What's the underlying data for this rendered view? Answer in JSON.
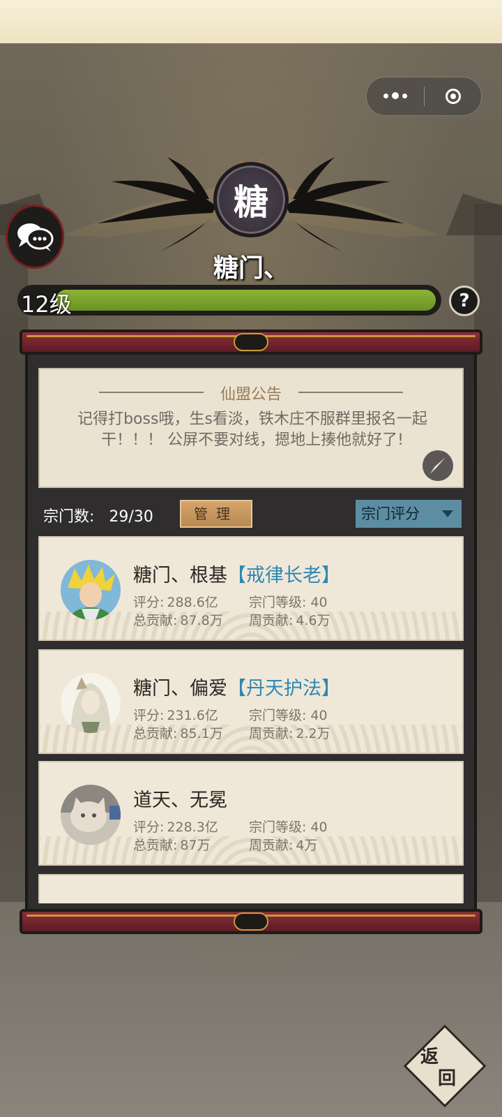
{
  "mini_program": {
    "more_icon": "more-dots-icon",
    "close_icon": "close-target-icon"
  },
  "sect": {
    "emblem_char": "糖",
    "name": "糖门、",
    "level_label": "12级",
    "level_progress": 1.0,
    "help_label": "?"
  },
  "notice": {
    "title": "仙盟公告",
    "text": "记得打boss哦，生s看淡，铁木庄不服群里报名一起干！！！ 公屏不要对线，摁地上揍他就好了!"
  },
  "members_header": {
    "count_label": "宗门数:",
    "count_value": "29/30",
    "manage_label": "管理",
    "sort_label": "宗门评分"
  },
  "members": [
    {
      "name": "糖门、根基",
      "title": "【戒律长老】",
      "score_label": "评分:",
      "score": "288.6亿",
      "level_label": "宗门等级:",
      "level": "40",
      "total_label": "总贡献:",
      "total": "87.8万",
      "weekly_label": "周贡献:",
      "weekly": "4.6万"
    },
    {
      "name": "糖门、偏爱",
      "title": "【丹天护法】",
      "score_label": "评分:",
      "score": "231.6亿",
      "level_label": "宗门等级:",
      "level": "40",
      "total_label": "总贡献:",
      "total": "85.1万",
      "weekly_label": "周贡献:",
      "weekly": "2.2万"
    },
    {
      "name": "道天、无冕",
      "title": "",
      "score_label": "评分:",
      "score": "228.3亿",
      "level_label": "宗门等级:",
      "level": "40",
      "total_label": "总贡献:",
      "total": "87万",
      "weekly_label": "周贡献:",
      "weekly": "4万"
    }
  ],
  "back": {
    "char1": "返",
    "char2": "回"
  },
  "colors": {
    "level_fill": "#7aa32a",
    "title_blue": "#2f87b3",
    "panel": "#2f2d2e",
    "frame_red": "#8b2e37"
  }
}
